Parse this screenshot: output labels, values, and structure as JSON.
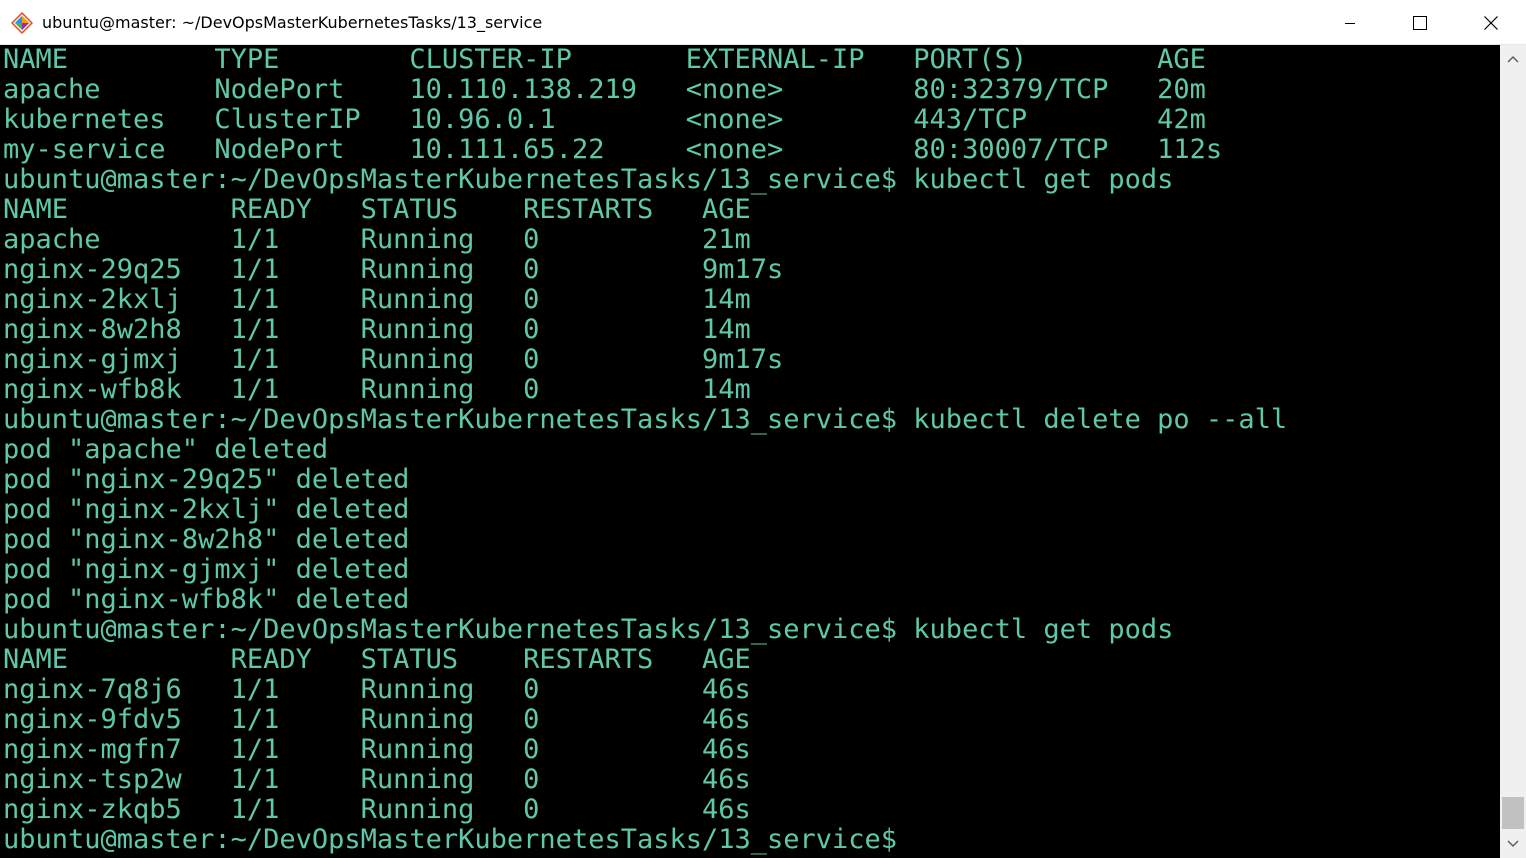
{
  "window": {
    "title": "ubuntu@master: ~/DevOpsMasterKubernetesTasks/13_service",
    "icon": "git-bash-icon",
    "buttons": {
      "minimize": "minimize-icon",
      "maximize": "maximize-icon",
      "close": "close-icon"
    }
  },
  "colors": {
    "terminal_background": "#000000",
    "terminal_text": "#60c8a8",
    "titlebar_background": "#ffffff"
  },
  "terminal": {
    "lines": [
      "NAME         TYPE        CLUSTER-IP       EXTERNAL-IP   PORT(S)        AGE",
      "apache       NodePort    10.110.138.219   <none>        80:32379/TCP   20m",
      "kubernetes   ClusterIP   10.96.0.1        <none>        443/TCP        42m",
      "my-service   NodePort    10.111.65.22     <none>        80:30007/TCP   112s",
      "ubuntu@master:~/DevOpsMasterKubernetesTasks/13_service$ kubectl get pods",
      "NAME          READY   STATUS    RESTARTS   AGE",
      "apache        1/1     Running   0          21m",
      "nginx-29q25   1/1     Running   0          9m17s",
      "nginx-2kxlj   1/1     Running   0          14m",
      "nginx-8w2h8   1/1     Running   0          14m",
      "nginx-gjmxj   1/1     Running   0          9m17s",
      "nginx-wfb8k   1/1     Running   0          14m",
      "ubuntu@master:~/DevOpsMasterKubernetesTasks/13_service$ kubectl delete po --all",
      "pod \"apache\" deleted",
      "pod \"nginx-29q25\" deleted",
      "pod \"nginx-2kxlj\" deleted",
      "pod \"nginx-8w2h8\" deleted",
      "pod \"nginx-gjmxj\" deleted",
      "pod \"nginx-wfb8k\" deleted",
      "ubuntu@master:~/DevOpsMasterKubernetesTasks/13_service$ kubectl get pods",
      "NAME          READY   STATUS    RESTARTS   AGE",
      "nginx-7q8j6   1/1     Running   0          46s",
      "nginx-9fdv5   1/1     Running   0          46s",
      "nginx-mgfn7   1/1     Running   0          46s",
      "nginx-tsp2w   1/1     Running   0          46s",
      "nginx-zkqb5   1/1     Running   0          46s",
      "ubuntu@master:~/DevOpsMasterKubernetesTasks/13_service$"
    ]
  },
  "scrollbar": {
    "up_icon": "scroll-up-arrow-icon",
    "down_icon": "scroll-down-arrow-icon",
    "position": 0.98
  }
}
